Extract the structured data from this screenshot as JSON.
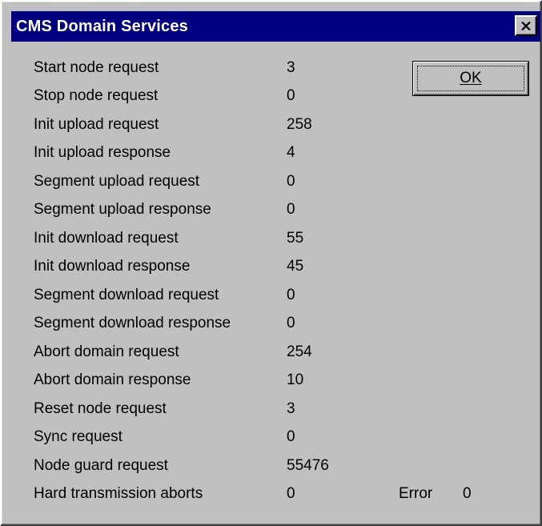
{
  "window": {
    "title": "CMS Domain Services",
    "close_symbol": "close-icon"
  },
  "ok_button": {
    "label": "OK"
  },
  "stats": [
    {
      "label": "Start node request",
      "value": "3"
    },
    {
      "label": "Stop  node request",
      "value": "0"
    },
    {
      "label": "Init upload request",
      "value": "258"
    },
    {
      "label": "Init upload response",
      "value": "4"
    },
    {
      "label": "Segment upload request",
      "value": "0"
    },
    {
      "label": "Segment upload response",
      "value": "0"
    },
    {
      "label": "Init download request",
      "value": "55"
    },
    {
      "label": "Init download response",
      "value": "45"
    },
    {
      "label": "Segment download request",
      "value": "0"
    },
    {
      "label": "Segment download response",
      "value": "0"
    },
    {
      "label": "Abort domain request",
      "value": "254"
    },
    {
      "label": "Abort domain response",
      "value": "10"
    },
    {
      "label": "Reset node request",
      "value": "3"
    },
    {
      "label": "Sync request",
      "value": "0"
    },
    {
      "label": "Node guard request",
      "value": "55476"
    },
    {
      "label": "Hard transmission aborts",
      "value": "0"
    }
  ],
  "error": {
    "label": "Error",
    "value": "0"
  },
  "colors": {
    "titlebar": "#000080",
    "face": "#c0c0c0"
  }
}
